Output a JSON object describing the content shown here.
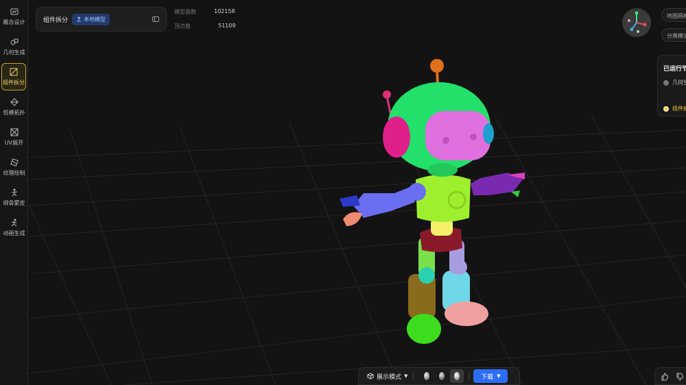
{
  "sidebar": {
    "items": [
      {
        "label": "概念设计",
        "icon": "concept-design-icon",
        "active": false
      },
      {
        "label": "几何生成",
        "icon": "geometry-icon",
        "active": false
      },
      {
        "label": "组件拆分",
        "icon": "component-split-icon",
        "active": true
      },
      {
        "label": "低模拓扑",
        "icon": "low-poly-icon",
        "active": false
      },
      {
        "label": "UV展开",
        "icon": "uv-unwrap-icon",
        "active": false
      },
      {
        "label": "纹理绘制",
        "icon": "texture-paint-icon",
        "active": false
      },
      {
        "label": "绑骨蒙皮",
        "icon": "rigging-icon",
        "active": false
      },
      {
        "label": "动画生成",
        "icon": "animation-icon",
        "active": false
      }
    ]
  },
  "component_panel": {
    "title": "组件拆分",
    "badge": "本地模型"
  },
  "stats": {
    "faces_label": "模型面数",
    "faces_value": "102158",
    "vertices_label": "顶点数",
    "vertices_value": "51109"
  },
  "right_buttons": {
    "texture_btn": "地图网格",
    "split_btn": "分离模式"
  },
  "run_panel": {
    "title": "已运行节点",
    "steps": [
      {
        "label": "几何生成",
        "status": "done"
      },
      {
        "label": "组件拆分",
        "status": "current"
      }
    ]
  },
  "toolbar": {
    "mode_label": "展示模式",
    "download_label": "下载"
  },
  "colors": {
    "accent": "#2b6df5",
    "active_border": "#c9a227",
    "background": "#131313"
  }
}
